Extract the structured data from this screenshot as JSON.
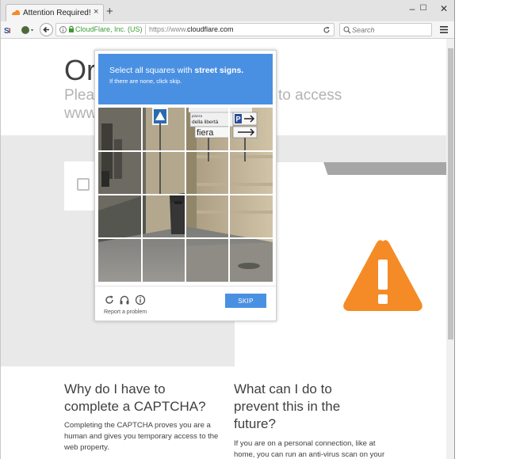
{
  "browser": {
    "tab_title": "Attention Required! | Clou...",
    "tab_close": "×",
    "new_tab": "+",
    "site_identity": "CloudFlare, Inc. (US)",
    "url_prefix": "https://www.",
    "url_domain": "cloudflare.com",
    "search_placeholder": "Search",
    "win_minimize": "–",
    "win_maximize": "☐",
    "win_close": "✕"
  },
  "page": {
    "heading_partial": "Or",
    "subtitle_line1_partial": "Pleas",
    "subtitle_line1_end": "to access",
    "subtitle_line2_partial": "www",
    "why_heading_line1": "Why do I have to",
    "why_heading_line2": "complete a CAPTCHA?",
    "why_body_line1": "Completing the CAPTCHA proves you are a",
    "why_body_line2": "human and gives you temporary access to the",
    "why_body_line3": "web property.",
    "what_heading_line1": "What can I do to",
    "what_heading_line2": "prevent this in the",
    "what_heading_line3": "future?",
    "what_body_line1": "If you are on a personal connection, like at",
    "what_body_line2": "home, you can run an anti-virus scan on your"
  },
  "captcha": {
    "instruction_prefix": "Select all squares with ",
    "instruction_target": "street signs.",
    "instruction_sub": "If there are none, click skip.",
    "skip_label": "SKIP",
    "report_label": "Report a problem",
    "sign_line1": "piazza",
    "sign_line2": "della libertà",
    "sign_line3": "fiera",
    "accent_color": "#4a90e2"
  },
  "colors": {
    "warning_orange": "#f48b26"
  }
}
